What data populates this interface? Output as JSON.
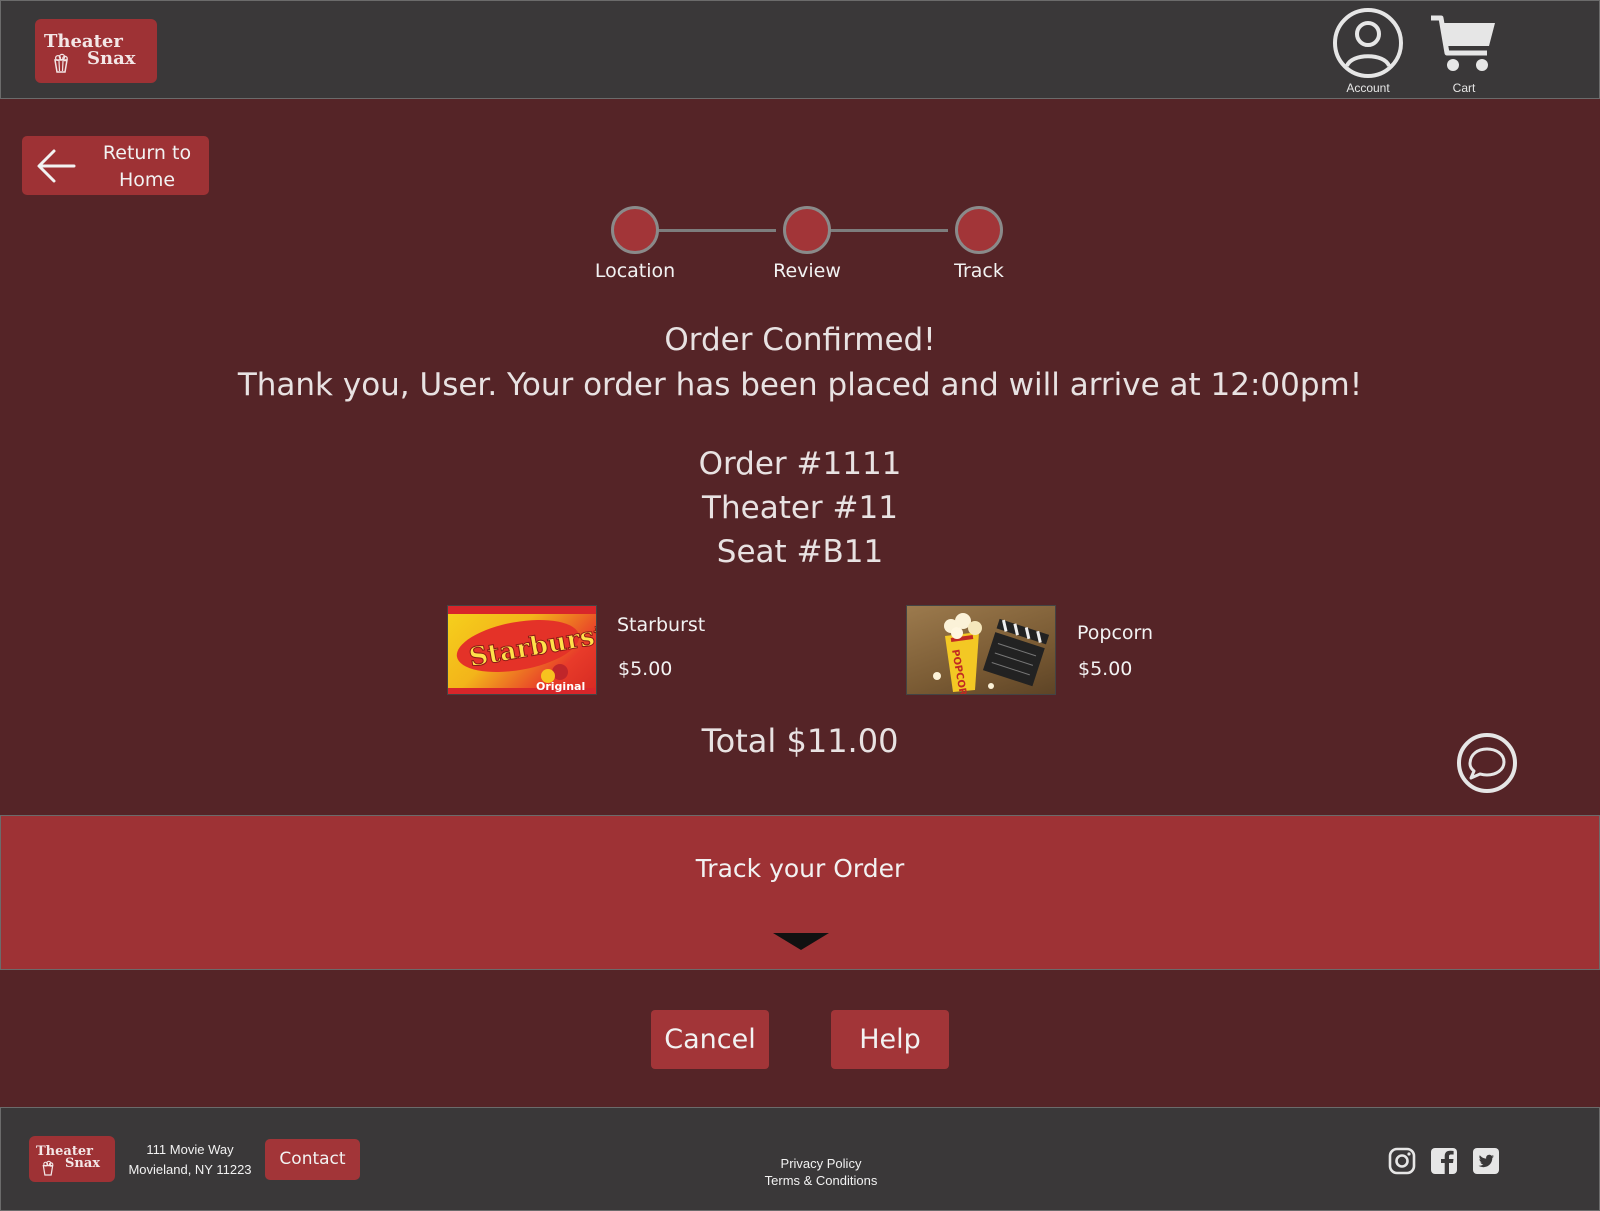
{
  "header": {
    "logo_line1": "Theater",
    "logo_line2": "Snax",
    "account_label": "Account",
    "cart_label": "Cart"
  },
  "nav": {
    "back_label": "Return to Home"
  },
  "steps": [
    {
      "label": "Location"
    },
    {
      "label": "Review"
    },
    {
      "label": "Track"
    }
  ],
  "confirmation": {
    "title": "Order Confirmed!",
    "message": "Thank you, User. Your order has been placed and will arrive at 12:00pm!"
  },
  "order": {
    "number": "Order #1111",
    "theater": "Theater #11",
    "seat": "Seat #B11"
  },
  "items": [
    {
      "name": "Starburst",
      "price": "$5.00"
    },
    {
      "name": "Popcorn",
      "price": "$5.00"
    }
  ],
  "total": "Total $11.00",
  "track": {
    "label": "Track your Order"
  },
  "actions": {
    "cancel_label": "Cancel",
    "help_label": "Help"
  },
  "footer": {
    "logo_line1": "Theater",
    "logo_line2": "Snax",
    "address_line1": "111 Movie Way",
    "address_line2": "Movieland, NY 11223",
    "contact_label": "Contact",
    "privacy_label": "Privacy Policy",
    "terms_label": "Terms & Conditions"
  },
  "colors": {
    "background": "#552427",
    "accent": "#9e3235",
    "chrome": "#3a3839"
  }
}
